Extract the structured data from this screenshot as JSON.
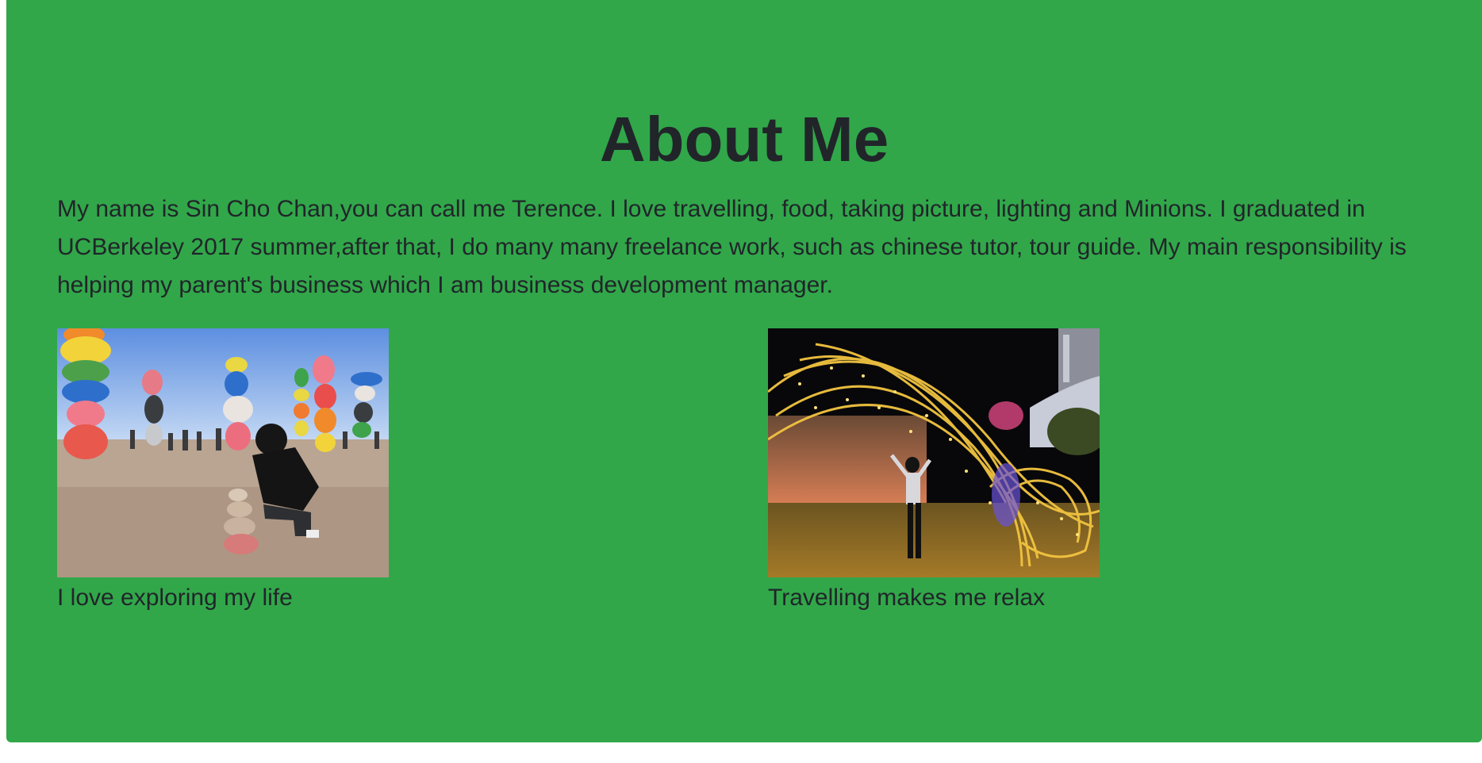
{
  "about": {
    "title": "About Me",
    "paragraph": "My name is Sin Cho Chan,you can call me Terence. I love travelling, food, taking picture, lighting and Minions. I graduated in UCBerkeley 2017 summer,after that, I do many many freelance work, such as chinese tutor, tour guide. My main responsibility is helping my parent's business which I am business development manager."
  },
  "photos": [
    {
      "caption": "I love exploring my life",
      "icon": "photo-rock-towers-desert"
    },
    {
      "caption": "Travelling makes me relax",
      "icon": "photo-light-tunnel-night"
    }
  ],
  "colors": {
    "background": "#31a74a",
    "text": "#212529"
  }
}
